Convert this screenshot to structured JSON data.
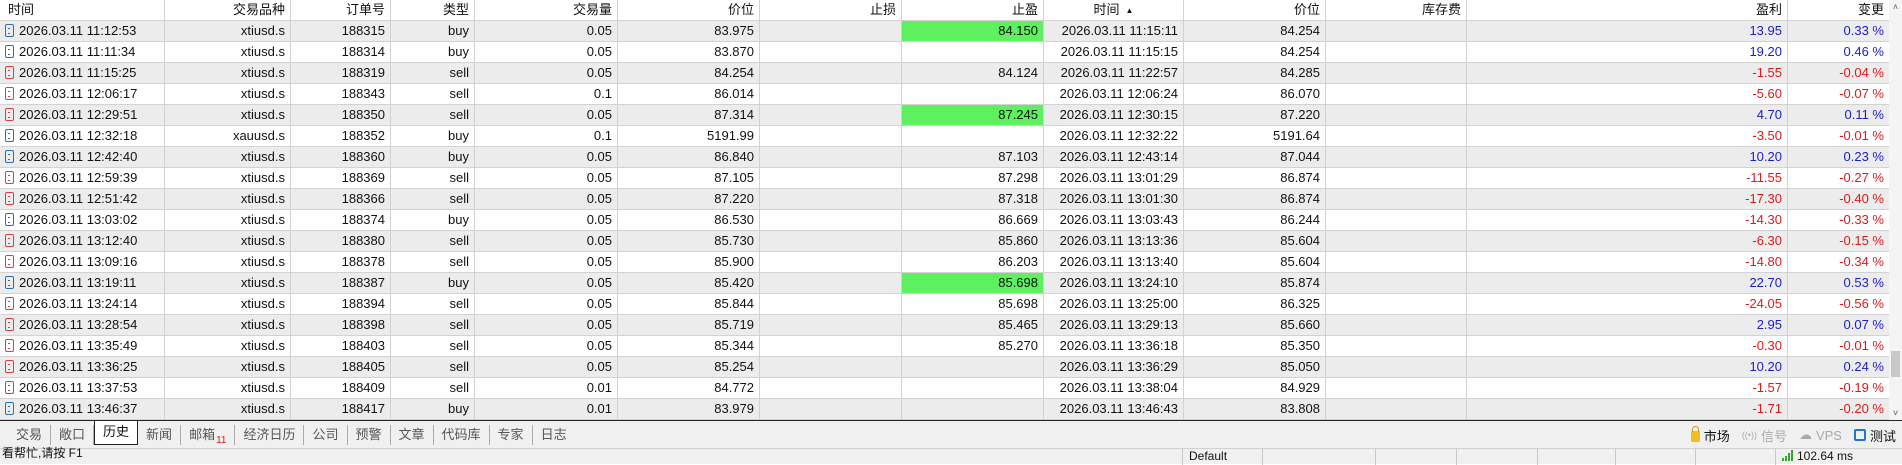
{
  "columns": [
    "时间",
    "交易品种",
    "订单号",
    "类型",
    "交易量",
    "价位",
    "止损",
    "止盈",
    "时间",
    "价位",
    "库存费",
    "盈利",
    "变更"
  ],
  "sort_indicator": "▲",
  "colors": {
    "tp_hit": "#5ef05e",
    "positive": "#1c1cc8",
    "negative": "#e01818"
  },
  "rows": [
    {
      "open_time": "2026.03.11 11:12:53",
      "symbol": "xtiusd.s",
      "order": "188315",
      "type": "buy",
      "volume": "0.05",
      "open_price": "83.975",
      "sl": "",
      "tp": "84.150",
      "tp_hit": true,
      "close_time": "2026.03.11 11:15:11",
      "close_price": "84.254",
      "swap": "",
      "profit": "13.95",
      "change": "0.33 %"
    },
    {
      "open_time": "2026.03.11 11:11:34",
      "symbol": "xtiusd.s",
      "order": "188314",
      "type": "buy",
      "volume": "0.05",
      "open_price": "83.870",
      "sl": "",
      "tp": "",
      "tp_hit": false,
      "close_time": "2026.03.11 11:15:15",
      "close_price": "84.254",
      "swap": "",
      "profit": "19.20",
      "change": "0.46 %"
    },
    {
      "open_time": "2026.03.11 11:15:25",
      "symbol": "xtiusd.s",
      "order": "188319",
      "type": "sell",
      "volume": "0.05",
      "open_price": "84.254",
      "sl": "",
      "tp": "84.124",
      "tp_hit": false,
      "close_time": "2026.03.11 11:22:57",
      "close_price": "84.285",
      "swap": "",
      "profit": "-1.55",
      "change": "-0.04 %"
    },
    {
      "open_time": "2026.03.11 12:06:17",
      "symbol": "xtiusd.s",
      "order": "188343",
      "type": "sell",
      "volume": "0.1",
      "open_price": "86.014",
      "sl": "",
      "tp": "",
      "tp_hit": false,
      "close_time": "2026.03.11 12:06:24",
      "close_price": "86.070",
      "swap": "",
      "profit": "-5.60",
      "change": "-0.07 %"
    },
    {
      "open_time": "2026.03.11 12:29:51",
      "symbol": "xtiusd.s",
      "order": "188350",
      "type": "sell",
      "volume": "0.05",
      "open_price": "87.314",
      "sl": "",
      "tp": "87.245",
      "tp_hit": true,
      "close_time": "2026.03.11 12:30:15",
      "close_price": "87.220",
      "swap": "",
      "profit": "4.70",
      "change": "0.11 %"
    },
    {
      "open_time": "2026.03.11 12:32:18",
      "symbol": "xauusd.s",
      "order": "188352",
      "type": "buy",
      "volume": "0.1",
      "open_price": "5191.99",
      "sl": "",
      "tp": "",
      "tp_hit": false,
      "close_time": "2026.03.11 12:32:22",
      "close_price": "5191.64",
      "swap": "",
      "profit": "-3.50",
      "change": "-0.01 %"
    },
    {
      "open_time": "2026.03.11 12:42:40",
      "symbol": "xtiusd.s",
      "order": "188360",
      "type": "buy",
      "volume": "0.05",
      "open_price": "86.840",
      "sl": "",
      "tp": "87.103",
      "tp_hit": false,
      "close_time": "2026.03.11 12:43:14",
      "close_price": "87.044",
      "swap": "",
      "profit": "10.20",
      "change": "0.23 %"
    },
    {
      "open_time": "2026.03.11 12:59:39",
      "symbol": "xtiusd.s",
      "order": "188369",
      "type": "sell",
      "volume": "0.05",
      "open_price": "87.105",
      "sl": "",
      "tp": "87.298",
      "tp_hit": false,
      "close_time": "2026.03.11 13:01:29",
      "close_price": "86.874",
      "swap": "",
      "profit": "-11.55",
      "change": "-0.27 %"
    },
    {
      "open_time": "2026.03.11 12:51:42",
      "symbol": "xtiusd.s",
      "order": "188366",
      "type": "sell",
      "volume": "0.05",
      "open_price": "87.220",
      "sl": "",
      "tp": "87.318",
      "tp_hit": false,
      "close_time": "2026.03.11 13:01:30",
      "close_price": "86.874",
      "swap": "",
      "profit": "-17.30",
      "change": "-0.40 %"
    },
    {
      "open_time": "2026.03.11 13:03:02",
      "symbol": "xtiusd.s",
      "order": "188374",
      "type": "buy",
      "volume": "0.05",
      "open_price": "86.530",
      "sl": "",
      "tp": "86.669",
      "tp_hit": false,
      "close_time": "2026.03.11 13:03:43",
      "close_price": "86.244",
      "swap": "",
      "profit": "-14.30",
      "change": "-0.33 %"
    },
    {
      "open_time": "2026.03.11 13:12:40",
      "symbol": "xtiusd.s",
      "order": "188380",
      "type": "sell",
      "volume": "0.05",
      "open_price": "85.730",
      "sl": "",
      "tp": "85.860",
      "tp_hit": false,
      "close_time": "2026.03.11 13:13:36",
      "close_price": "85.604",
      "swap": "",
      "profit": "-6.30",
      "change": "-0.15 %"
    },
    {
      "open_time": "2026.03.11 13:09:16",
      "symbol": "xtiusd.s",
      "order": "188378",
      "type": "sell",
      "volume": "0.05",
      "open_price": "85.900",
      "sl": "",
      "tp": "86.203",
      "tp_hit": false,
      "close_time": "2026.03.11 13:13:40",
      "close_price": "85.604",
      "swap": "",
      "profit": "-14.80",
      "change": "-0.34 %"
    },
    {
      "open_time": "2026.03.11 13:19:11",
      "symbol": "xtiusd.s",
      "order": "188387",
      "type": "buy",
      "volume": "0.05",
      "open_price": "85.420",
      "sl": "",
      "tp": "85.698",
      "tp_hit": true,
      "close_time": "2026.03.11 13:24:10",
      "close_price": "85.874",
      "swap": "",
      "profit": "22.70",
      "change": "0.53 %"
    },
    {
      "open_time": "2026.03.11 13:24:14",
      "symbol": "xtiusd.s",
      "order": "188394",
      "type": "sell",
      "volume": "0.05",
      "open_price": "85.844",
      "sl": "",
      "tp": "85.698",
      "tp_hit": false,
      "close_time": "2026.03.11 13:25:00",
      "close_price": "86.325",
      "swap": "",
      "profit": "-24.05",
      "change": "-0.56 %"
    },
    {
      "open_time": "2026.03.11 13:28:54",
      "symbol": "xtiusd.s",
      "order": "188398",
      "type": "sell",
      "volume": "0.05",
      "open_price": "85.719",
      "sl": "",
      "tp": "85.465",
      "tp_hit": false,
      "close_time": "2026.03.11 13:29:13",
      "close_price": "85.660",
      "swap": "",
      "profit": "2.95",
      "change": "0.07 %"
    },
    {
      "open_time": "2026.03.11 13:35:49",
      "symbol": "xtiusd.s",
      "order": "188403",
      "type": "sell",
      "volume": "0.05",
      "open_price": "85.344",
      "sl": "",
      "tp": "85.270",
      "tp_hit": false,
      "close_time": "2026.03.11 13:36:18",
      "close_price": "85.350",
      "swap": "",
      "profit": "-0.30",
      "change": "-0.01 %"
    },
    {
      "open_time": "2026.03.11 13:36:25",
      "symbol": "xtiusd.s",
      "order": "188405",
      "type": "sell",
      "volume": "0.05",
      "open_price": "85.254",
      "sl": "",
      "tp": "",
      "tp_hit": false,
      "close_time": "2026.03.11 13:36:29",
      "close_price": "85.050",
      "swap": "",
      "profit": "10.20",
      "change": "0.24 %"
    },
    {
      "open_time": "2026.03.11 13:37:53",
      "symbol": "xtiusd.s",
      "order": "188409",
      "type": "sell",
      "volume": "0.01",
      "open_price": "84.772",
      "sl": "",
      "tp": "",
      "tp_hit": false,
      "close_time": "2026.03.11 13:38:04",
      "close_price": "84.929",
      "swap": "",
      "profit": "-1.57",
      "change": "-0.19 %"
    },
    {
      "open_time": "2026.03.11 13:46:37",
      "symbol": "xtiusd.s",
      "order": "188417",
      "type": "buy",
      "volume": "0.01",
      "open_price": "83.979",
      "sl": "",
      "tp": "",
      "tp_hit": false,
      "close_time": "2026.03.11 13:46:43",
      "close_price": "83.808",
      "swap": "",
      "profit": "-1.71",
      "change": "-0.20 %"
    }
  ],
  "scrollbar": {
    "up": "˄",
    "down": "˅"
  },
  "tabs": [
    {
      "label": "交易"
    },
    {
      "label": "敞口"
    },
    {
      "label": "历史",
      "active": true
    },
    {
      "label": "新闻"
    },
    {
      "label": "邮箱",
      "badge": "11"
    },
    {
      "label": "经济日历"
    },
    {
      "label": "公司"
    },
    {
      "label": "预警"
    },
    {
      "label": "文章"
    },
    {
      "label": "代码库"
    },
    {
      "label": "专家"
    },
    {
      "label": "日志"
    }
  ],
  "right_tabs": {
    "market": "市场",
    "signal_icon": "((•))",
    "signal": "信号",
    "vps_icon": "☁",
    "vps": "VPS",
    "test": "测试"
  },
  "status": {
    "help": "看帮忙,请按 F1",
    "profile": "Default",
    "ping": "102.64 ms"
  }
}
